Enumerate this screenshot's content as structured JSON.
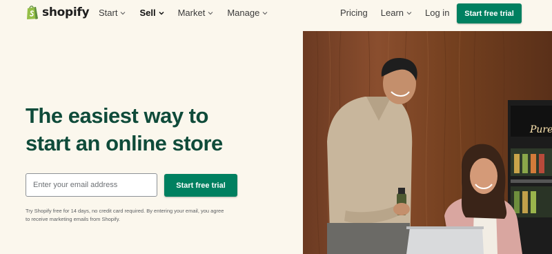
{
  "nav": {
    "logo_text": "shopify",
    "left_items": [
      {
        "label": "Start",
        "has_dropdown": true
      },
      {
        "label": "Sell",
        "has_dropdown": true
      },
      {
        "label": "Market",
        "has_dropdown": true
      },
      {
        "label": "Manage",
        "has_dropdown": true
      }
    ],
    "pricing": "Pricing",
    "learn": "Learn",
    "login": "Log in",
    "cta": "Start free trial"
  },
  "hero": {
    "title_line1": "The easiest way to",
    "title_line2": "start an online store",
    "email_placeholder": "Enter your email address",
    "cta": "Start free trial",
    "disclaimer_line1": "Try Shopify free for 14 days, no credit card required. By entering your email, you agree",
    "disclaimer_line2": "to receive marketing emails from Shopify."
  },
  "photo": {
    "sign_text": "Pure i"
  },
  "colors": {
    "brand_green": "#008060",
    "title_green": "#0f4b3a",
    "background": "#fbf7ed"
  }
}
